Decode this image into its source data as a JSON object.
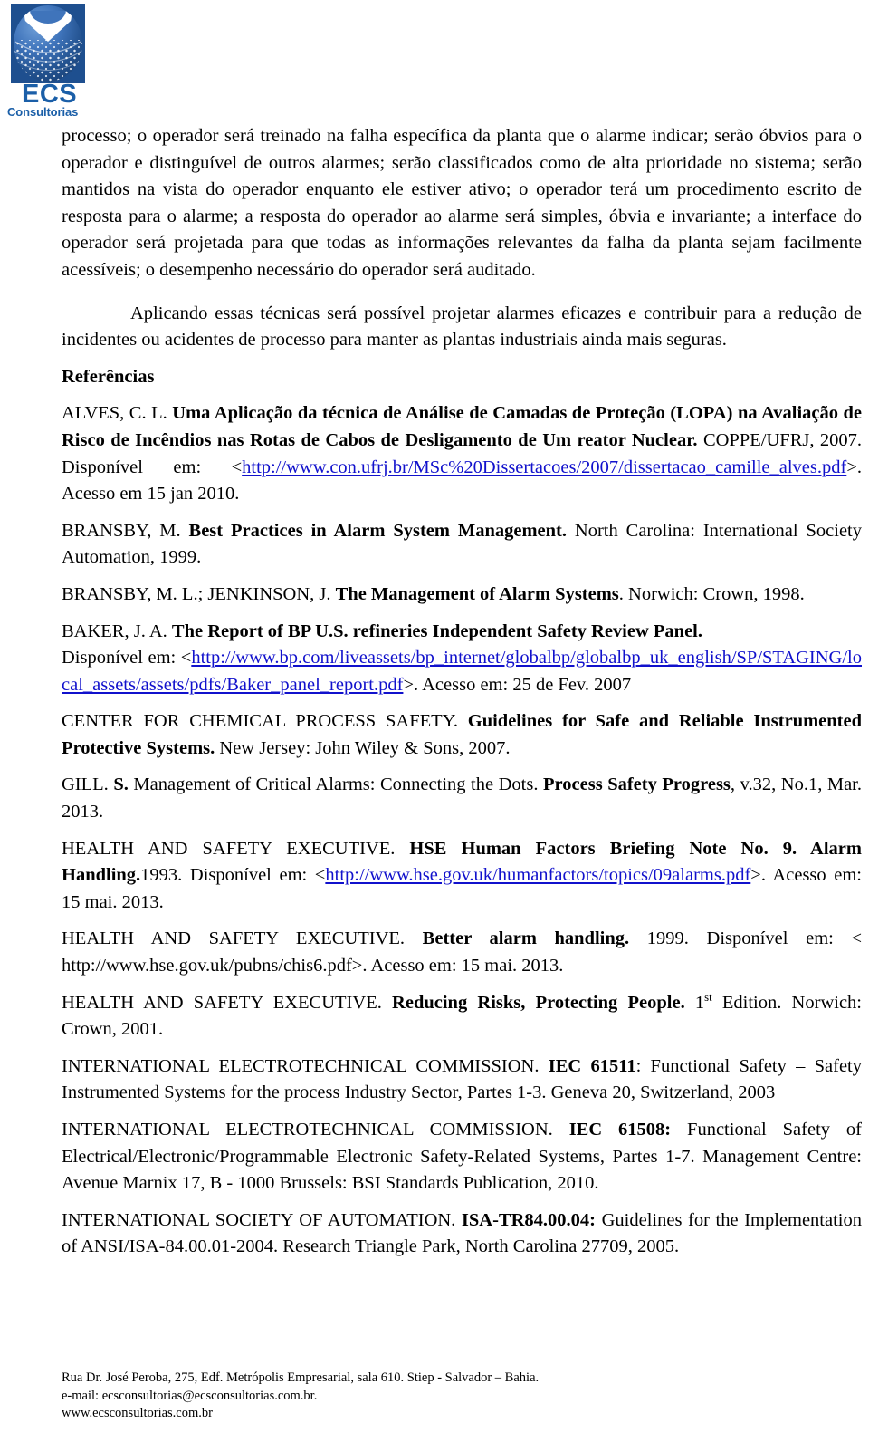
{
  "logo": {
    "mark_name": "ecs-sphere-logo",
    "brand": "ECS",
    "tagline": "Consultorias",
    "brand_color": "#1b5fa8",
    "square_color": "#1e4f8f"
  },
  "body": {
    "paragraph_1": "processo; o operador será treinado na falha específica da planta que o alarme indicar; serão óbvios para o operador e distinguível de outros alarmes; serão classificados como de alta prioridade no sistema; serão mantidos na vista do operador enquanto ele estiver ativo; o operador terá um procedimento escrito de resposta para o alarme; a resposta do operador ao alarme será simples, óbvia e invariante; a interface do operador será projetada para que todas as informações relevantes da falha da planta sejam facilmente acessíveis; o desempenho necessário do operador será auditado.",
    "paragraph_2": "Aplicando essas técnicas será possível projetar alarmes eficazes e contribuir para a redução de incidentes ou acidentes de processo para manter as plantas industriais ainda mais seguras."
  },
  "references_heading": "Referências",
  "references": [
    {
      "id": "alves",
      "author": "ALVES, C. L. ",
      "title": "Uma Aplicação da técnica de Análise de Camadas de Proteção (LOPA) na Avaliação de Risco de Incêndios nas Rotas de Cabos de Desligamento de Um reator Nuclear.",
      "mid": "COPPE/UFRJ, 2007. Disponível em: <",
      "url": "http://www.con.ufrj.br/MSc%20Dissertacoes/2007/dissertacao_camille_alves.pdf",
      "tail": ">. Acesso em 15 jan 2010."
    },
    {
      "id": "bransby-1999",
      "author": "BRANSBY, M. ",
      "title": "Best Practices in Alarm System Management.",
      "tail": " North Carolina: International Society Automation, 1999."
    },
    {
      "id": "bransby-jenkinson-1998",
      "author": "BRANSBY, M. L.; JENKINSON, J. ",
      "title": "The Management of Alarm Systems",
      "tail": ". Norwich: Crown, 1998."
    },
    {
      "id": "baker",
      "author": "BAKER, J. A. ",
      "title": "The Report of BP U.S. refineries Independent Safety Review Panel.",
      "mid": "Disponível em: <",
      "url": "http://www.bp.com/liveassets/bp_internet/globalbp/globalbp_uk_english/SP/STAGING/local_assets/assets/pdfs/Baker_panel_report.pdf",
      "tail": ">. Acesso em: 25 de Fev. 2007"
    },
    {
      "id": "ccps",
      "author": "CENTER FOR CHEMICAL PROCESS SAFETY. ",
      "title": "Guidelines for Safe and Reliable Instrumented Protective Systems.",
      "tail": " New Jersey: John Wiley & Sons, 2007."
    },
    {
      "id": "gill",
      "author": "GILL. ",
      "initial": "S.",
      "mid": " Management of Critical Alarms: Connecting the Dots. ",
      "title": "Process Safety Progress",
      "tail": ", v.32, No.1, Mar. 2013."
    },
    {
      "id": "hse-1993",
      "author": " HEALTH AND SAFETY EXECUTIVE. ",
      "title": "HSE Human Factors Briefing Note No. 9. Alarm Handling.",
      "mid": "1993. Disponível em: <",
      "url": "http://www.hse.gov.uk/humanfactors/topics/09alarms.pdf",
      "tail": ">. Acesso em: 15 mai. 2013."
    },
    {
      "id": "hse-1999",
      "author": "HEALTH AND SAFETY EXECUTIVE. ",
      "title": "Better alarm handling.",
      "mid": " 1999. Disponível em: < ",
      "url_plain": "http://www.hse.gov.uk/pubns/chis6.pdf",
      "tail": ">. Acesso em: 15 mai. 2013."
    },
    {
      "id": "hse-2001",
      "author": "HEALTH AND SAFETY EXECUTIVE. ",
      "title": "Reducing Risks, Protecting People.",
      "edition_num": "1",
      "edition_sup": "st",
      "tail": " Edition. Norwich: Crown, 2001."
    },
    {
      "id": "iec-61511",
      "author": "INTERNATIONAL ELECTROTECHNICAL COMMISSION.  ",
      "title": "IEC 61511",
      "tail": ": Functional Safety – Safety Instrumented Systems for the process Industry Sector, Partes 1-3. Geneva 20, Switzerland, 2003"
    },
    {
      "id": "iec-61508",
      "author": "INTERNATIONAL ELECTROTECHNICAL COMMISSION.  ",
      "title": "IEC 61508:",
      "tail": " Functional Safety of Electrical/Electronic/Programmable Electronic Safety-Related Systems, Partes 1-7. Management Centre: Avenue Marnix 17, B - 1000 Brussels: BSI Standards Publication, 2010."
    },
    {
      "id": "isa",
      "author": "INTERNATIONAL SOCIETY OF AUTOMATION. ",
      "title": "ISA-TR84.00.04:",
      "tail": " Guidelines for the Implementation of ANSI/ISA-84.00.01-2004. Research Triangle Park, North Carolina 27709, 2005."
    }
  ],
  "footer": {
    "address": "Rua Dr. José Peroba, 275, Edf. Metrópolis Empresarial, sala 610. Stiep - Salvador – Bahia.",
    "email": "e-mail: ecsconsultorias@ecsconsultorias.com.br.",
    "website": "www.ecsconsultorias.com.br"
  }
}
